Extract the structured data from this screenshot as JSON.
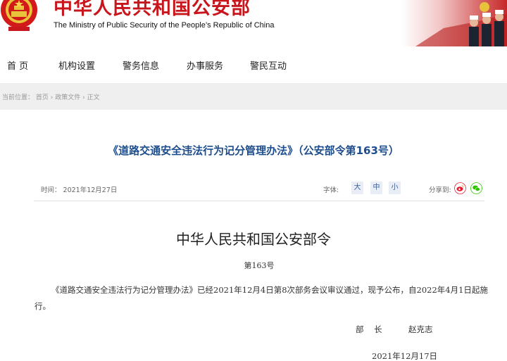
{
  "header": {
    "title": "中华人民共和国公安部",
    "subtitle": "The Ministry of Public Security of the People’s Republic of China"
  },
  "nav": {
    "items": [
      "首 页",
      "机构设置",
      "警务信息",
      "办事服务",
      "警民互动"
    ]
  },
  "breadcrumb": {
    "prefix": "当前位置：",
    "items": [
      "首页",
      "政策文件",
      "正文"
    ],
    "separator": "›"
  },
  "article": {
    "title": "《道路交通安全违法行为记分管理办法》（公安部令第163号）",
    "time_label": "时间：",
    "time_value": "2021年12月27日",
    "font_label": "字体:",
    "font_sizes": [
      "大",
      "中",
      "小"
    ],
    "share_label": "分享到:",
    "share_icons": [
      "weibo-icon",
      "wechat-icon"
    ],
    "order_title": "中华人民共和国公安部令",
    "order_no": "第163号",
    "paragraph": "《道路交通安全违法行为记分管理办法》已经2021年12月4日第8次部务会议审议通过，现予公布，自2022年4月1日起施行。",
    "sign_role": "部    长",
    "sign_name": "赵克志",
    "sign_date": "2021年12月17日"
  },
  "colors": {
    "brand_red": "#c8161d",
    "title_blue": "#1d4d8c",
    "weibo": "#e6162d",
    "wechat": "#2dc100"
  }
}
